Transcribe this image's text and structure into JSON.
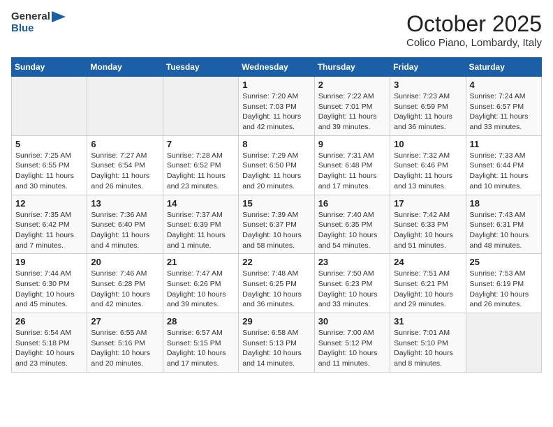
{
  "header": {
    "logo_general": "General",
    "logo_blue": "Blue",
    "title": "October 2025",
    "subtitle": "Colico Piano, Lombardy, Italy"
  },
  "days_of_week": [
    "Sunday",
    "Monday",
    "Tuesday",
    "Wednesday",
    "Thursday",
    "Friday",
    "Saturday"
  ],
  "weeks": [
    [
      {
        "num": "",
        "info": ""
      },
      {
        "num": "",
        "info": ""
      },
      {
        "num": "",
        "info": ""
      },
      {
        "num": "1",
        "info": "Sunrise: 7:20 AM\nSunset: 7:03 PM\nDaylight: 11 hours\nand 42 minutes."
      },
      {
        "num": "2",
        "info": "Sunrise: 7:22 AM\nSunset: 7:01 PM\nDaylight: 11 hours\nand 39 minutes."
      },
      {
        "num": "3",
        "info": "Sunrise: 7:23 AM\nSunset: 6:59 PM\nDaylight: 11 hours\nand 36 minutes."
      },
      {
        "num": "4",
        "info": "Sunrise: 7:24 AM\nSunset: 6:57 PM\nDaylight: 11 hours\nand 33 minutes."
      }
    ],
    [
      {
        "num": "5",
        "info": "Sunrise: 7:25 AM\nSunset: 6:55 PM\nDaylight: 11 hours\nand 30 minutes."
      },
      {
        "num": "6",
        "info": "Sunrise: 7:27 AM\nSunset: 6:54 PM\nDaylight: 11 hours\nand 26 minutes."
      },
      {
        "num": "7",
        "info": "Sunrise: 7:28 AM\nSunset: 6:52 PM\nDaylight: 11 hours\nand 23 minutes."
      },
      {
        "num": "8",
        "info": "Sunrise: 7:29 AM\nSunset: 6:50 PM\nDaylight: 11 hours\nand 20 minutes."
      },
      {
        "num": "9",
        "info": "Sunrise: 7:31 AM\nSunset: 6:48 PM\nDaylight: 11 hours\nand 17 minutes."
      },
      {
        "num": "10",
        "info": "Sunrise: 7:32 AM\nSunset: 6:46 PM\nDaylight: 11 hours\nand 13 minutes."
      },
      {
        "num": "11",
        "info": "Sunrise: 7:33 AM\nSunset: 6:44 PM\nDaylight: 11 hours\nand 10 minutes."
      }
    ],
    [
      {
        "num": "12",
        "info": "Sunrise: 7:35 AM\nSunset: 6:42 PM\nDaylight: 11 hours\nand 7 minutes."
      },
      {
        "num": "13",
        "info": "Sunrise: 7:36 AM\nSunset: 6:40 PM\nDaylight: 11 hours\nand 4 minutes."
      },
      {
        "num": "14",
        "info": "Sunrise: 7:37 AM\nSunset: 6:39 PM\nDaylight: 11 hours\nand 1 minute."
      },
      {
        "num": "15",
        "info": "Sunrise: 7:39 AM\nSunset: 6:37 PM\nDaylight: 10 hours\nand 58 minutes."
      },
      {
        "num": "16",
        "info": "Sunrise: 7:40 AM\nSunset: 6:35 PM\nDaylight: 10 hours\nand 54 minutes."
      },
      {
        "num": "17",
        "info": "Sunrise: 7:42 AM\nSunset: 6:33 PM\nDaylight: 10 hours\nand 51 minutes."
      },
      {
        "num": "18",
        "info": "Sunrise: 7:43 AM\nSunset: 6:31 PM\nDaylight: 10 hours\nand 48 minutes."
      }
    ],
    [
      {
        "num": "19",
        "info": "Sunrise: 7:44 AM\nSunset: 6:30 PM\nDaylight: 10 hours\nand 45 minutes."
      },
      {
        "num": "20",
        "info": "Sunrise: 7:46 AM\nSunset: 6:28 PM\nDaylight: 10 hours\nand 42 minutes."
      },
      {
        "num": "21",
        "info": "Sunrise: 7:47 AM\nSunset: 6:26 PM\nDaylight: 10 hours\nand 39 minutes."
      },
      {
        "num": "22",
        "info": "Sunrise: 7:48 AM\nSunset: 6:25 PM\nDaylight: 10 hours\nand 36 minutes."
      },
      {
        "num": "23",
        "info": "Sunrise: 7:50 AM\nSunset: 6:23 PM\nDaylight: 10 hours\nand 33 minutes."
      },
      {
        "num": "24",
        "info": "Sunrise: 7:51 AM\nSunset: 6:21 PM\nDaylight: 10 hours\nand 29 minutes."
      },
      {
        "num": "25",
        "info": "Sunrise: 7:53 AM\nSunset: 6:19 PM\nDaylight: 10 hours\nand 26 minutes."
      }
    ],
    [
      {
        "num": "26",
        "info": "Sunrise: 6:54 AM\nSunset: 5:18 PM\nDaylight: 10 hours\nand 23 minutes."
      },
      {
        "num": "27",
        "info": "Sunrise: 6:55 AM\nSunset: 5:16 PM\nDaylight: 10 hours\nand 20 minutes."
      },
      {
        "num": "28",
        "info": "Sunrise: 6:57 AM\nSunset: 5:15 PM\nDaylight: 10 hours\nand 17 minutes."
      },
      {
        "num": "29",
        "info": "Sunrise: 6:58 AM\nSunset: 5:13 PM\nDaylight: 10 hours\nand 14 minutes."
      },
      {
        "num": "30",
        "info": "Sunrise: 7:00 AM\nSunset: 5:12 PM\nDaylight: 10 hours\nand 11 minutes."
      },
      {
        "num": "31",
        "info": "Sunrise: 7:01 AM\nSunset: 5:10 PM\nDaylight: 10 hours\nand 8 minutes."
      },
      {
        "num": "",
        "info": ""
      }
    ]
  ]
}
